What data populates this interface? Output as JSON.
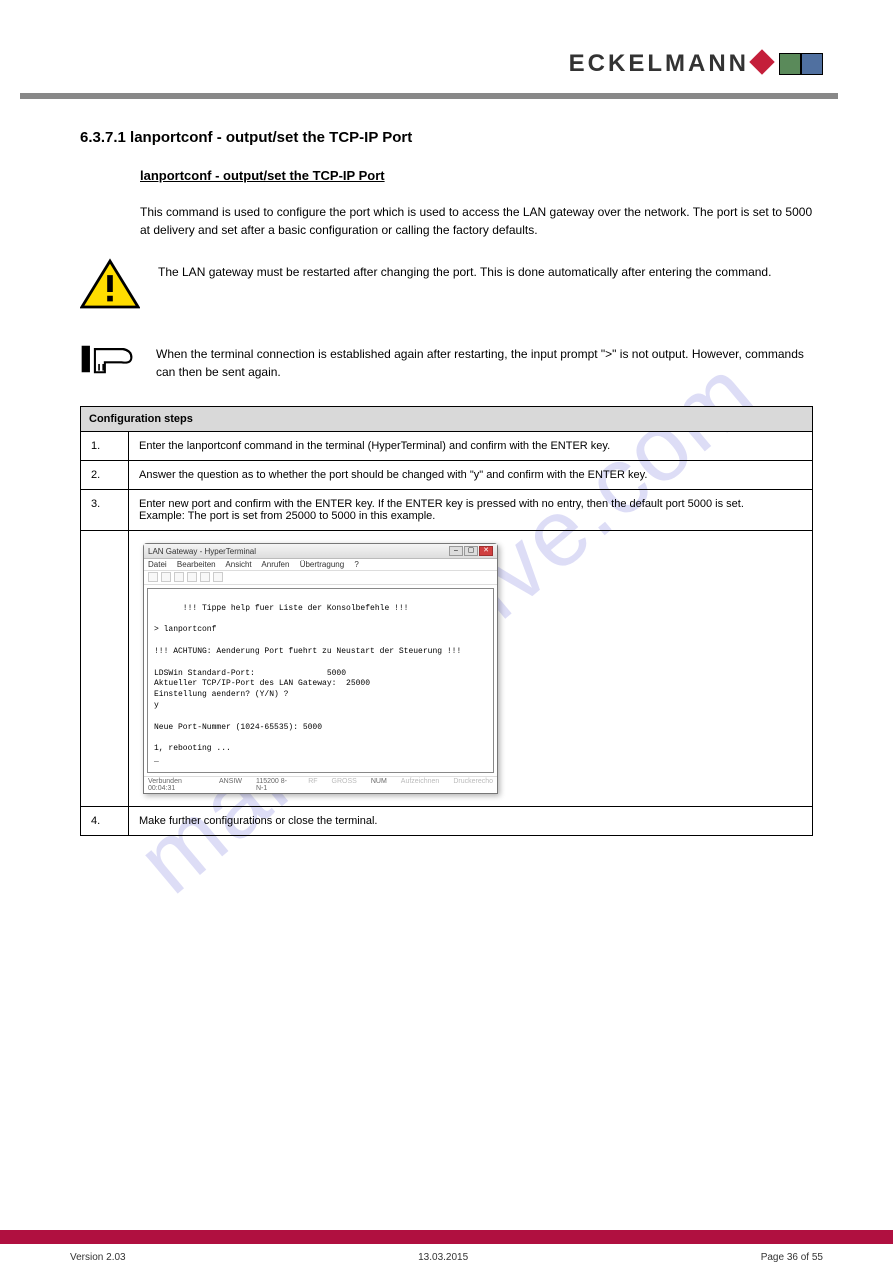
{
  "logo_text": "ECKELMANN",
  "watermark": "manualshive.com",
  "heading": "6.3.7.1 lanportconf - output/set the TCP-IP Port",
  "subhead": "lanportconf - output/set the TCP-IP Port",
  "para1": "This command is used to configure the port which is used to access the LAN gateway over the network. The port is set to 5000 at delivery and set after a basic configuration or calling the factory defaults.",
  "warn_text": "The LAN gateway must be restarted after changing the port. This is done automatically after entering the command.",
  "note_text": "When the terminal connection is established again after restarting, the input prompt \">\" is not output. However, commands can then be sent again.",
  "table_header": "Configuration steps",
  "rows": [
    {
      "step": "1.",
      "text": "Enter the lanportconf command in the terminal (HyperTerminal) and confirm with the ENTER key."
    },
    {
      "step": "2.",
      "text": "Answer the question as to whether the port should be changed with \"y\" and confirm with the ENTER key."
    },
    {
      "step": "3.",
      "text": "Enter new port and confirm with the ENTER key. If the ENTER key is pressed with no entry, then the default port 5000 is set.\nExample: The port is set from 25000 to 5000 in this example."
    },
    {
      "step": "4.",
      "text": "Make further configurations or close the terminal."
    }
  ],
  "terminal": {
    "title": "LAN Gateway - HyperTerminal",
    "menu": [
      "Datei",
      "Bearbeiten",
      "Ansicht",
      "Anrufen",
      "Übertragung",
      "?"
    ],
    "body_lines": [
      "",
      "      !!! Tippe help fuer Liste der Konsolbefehle !!!",
      "",
      "> lanportconf",
      "",
      "!!! ACHTUNG: Aenderung Port fuehrt zu Neustart der Steuerung !!!",
      "",
      "LDSWin Standard-Port:               5000",
      "Aktueller TCP/IP-Port des LAN Gateway:  25000",
      "Einstellung aendern? (Y/N) ?",
      "y",
      "",
      "Neue Port-Nummer (1024-65535): 5000",
      "",
      "1, rebooting ...",
      "_"
    ],
    "status": [
      "Verbunden 00:04:31",
      "ANSIW",
      "115200 8-N-1",
      "RF",
      "GROSS",
      "NUM",
      "Aufzeichnen",
      "Druckerecho"
    ]
  },
  "footer_left": "Version 2.03",
  "footer_center": "13.03.2015",
  "footer_right": "Page 36 of 55"
}
